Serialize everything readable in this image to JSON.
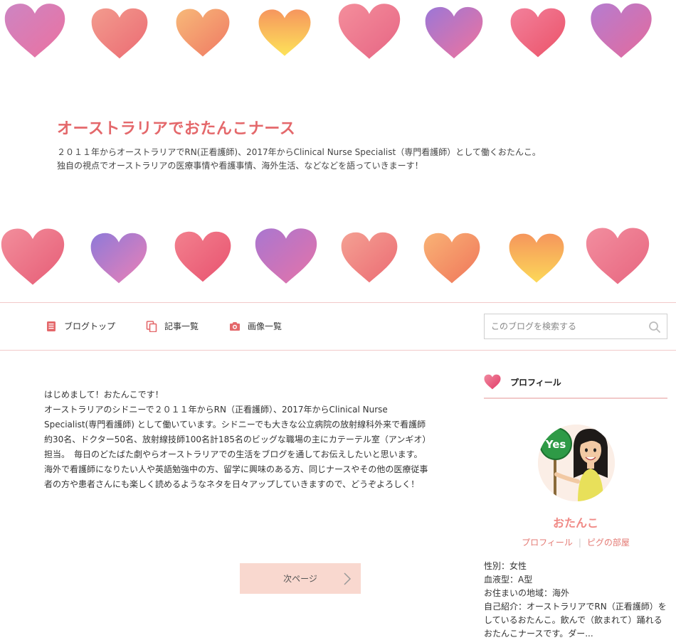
{
  "blog": {
    "title": "オーストラリアでおたんこナース",
    "description": "２０１１年からオーストラリアでRN(正看護師)、2017年からClinical Nurse Specialist（専門看護師）として働くおたんこ。独自の視点でオーストラリアの医療事情や看護事情、海外生活、などなどを語っていきまーす！"
  },
  "nav": {
    "items": [
      {
        "label": "ブログトップ",
        "icon": "document-icon"
      },
      {
        "label": "記事一覧",
        "icon": "pages-icon"
      },
      {
        "label": "画像一覧",
        "icon": "camera-icon"
      }
    ],
    "search_placeholder": "このブログを検索する"
  },
  "main": {
    "paragraphs": [
      "はじめまして！おたんこです！",
      "オーストラリアのシドニーで２０１１年からRN（正看護師）、2017年からClinical Nurse Specialist(専門看護師) として働いています。シドニーでも大きな公立病院の放射線科外来で看護師約30名、ドクター50名、放射線技師100名計185名のビッグな職場の主にカテーテル室（アンギオ）担当。　毎日のどたばた劇やらオーストラリアでの生活をブログを通してお伝えしたいと思います。",
      "海外で看護師になりたい人や英語勉強中の方、留学に興味のある方、同じナースやその他の医療従事者の方や患者さんにも楽しく読めるようなネタを日々アップしていきますので、どうぞよろしく！"
    ],
    "next_button": "次ページ"
  },
  "sidebar": {
    "profile_heading": "プロフィール",
    "avatar_sign": "Yes",
    "nickname": "おたんこ",
    "links": [
      "プロフィール",
      "ピグの部屋"
    ],
    "info": [
      "性別：女性",
      "血液型：A型",
      "お住まいの地域：海外",
      "自己紹介：オーストラリアでRN（正看護師）をしているおたんこ。飲んで（飲まれて）踊れるおたんこナースです。ダー..."
    ]
  },
  "colors": {
    "accent": "#e4686b",
    "nav_border": "#f2c9c9",
    "button_bg": "#f9d8cf"
  }
}
